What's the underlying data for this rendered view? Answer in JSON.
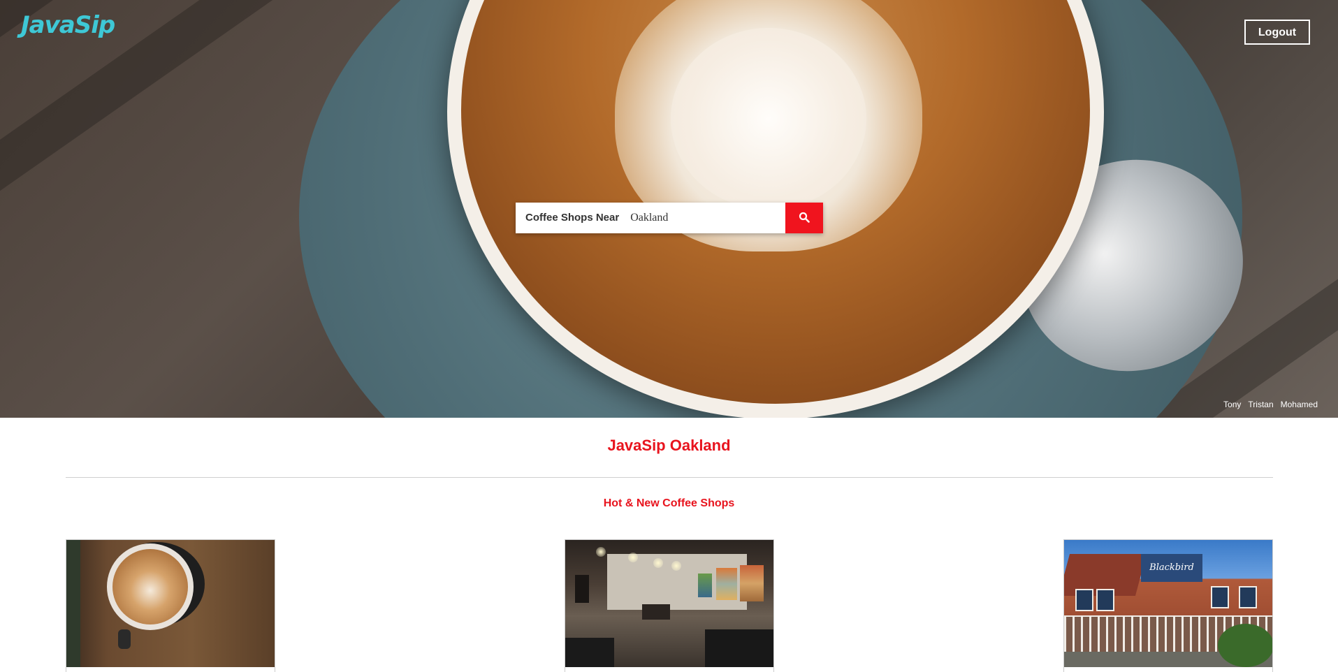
{
  "header": {
    "logo_text": "JavaSip",
    "logout_label": "Logout"
  },
  "search": {
    "label": "Coffee Shops Near",
    "value": "Oakland"
  },
  "credits": [
    "Tony",
    "Tristan",
    "Mohamed"
  ],
  "main": {
    "city_title": "JavaSip Oakland",
    "section_title": "Hot & New Coffee Shops"
  },
  "colors": {
    "accent": "#e8141e",
    "logo": "#3ec8d6",
    "search_button": "#f0141e"
  },
  "icons": {
    "search": "search-icon"
  }
}
